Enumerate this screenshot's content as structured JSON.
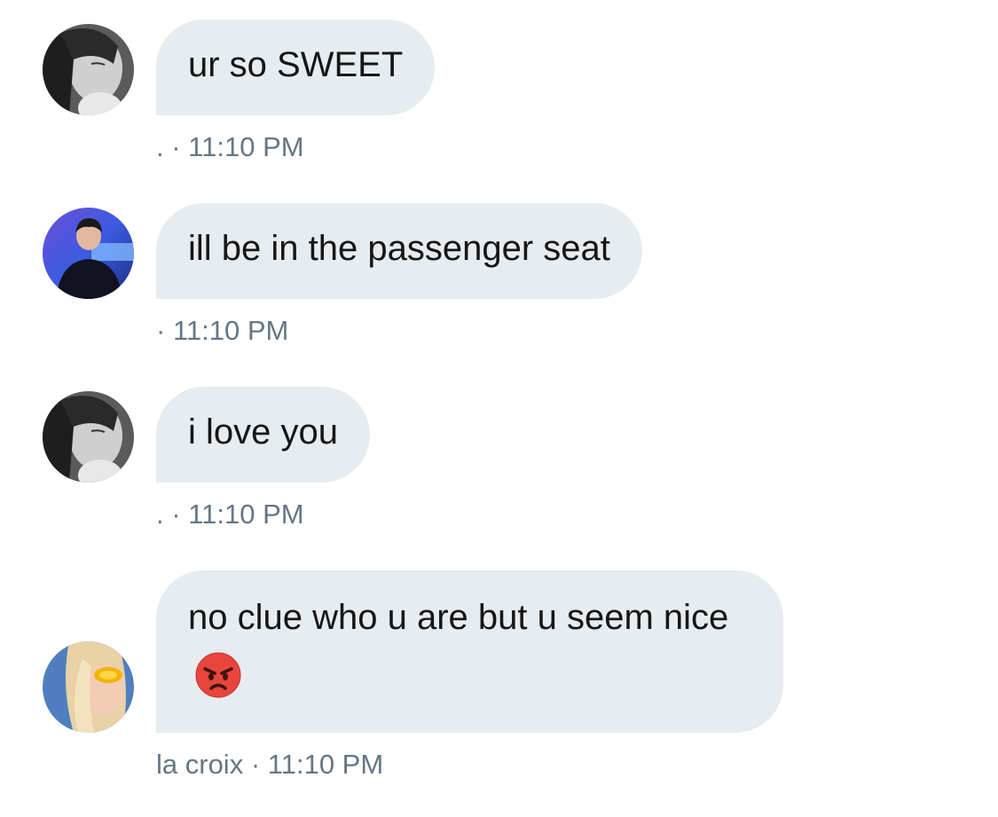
{
  "messages": [
    {
      "text": "ur so SWEET",
      "sender": ".",
      "separator": "·",
      "time": "11:10 PM",
      "avatar": "grayscale-portrait-avatar"
    },
    {
      "text": "ill be in the passenger seat",
      "sender": "",
      "separator": "·",
      "time": "11:10 PM",
      "avatar": "concert-stage-avatar"
    },
    {
      "text": "i love you",
      "sender": ".",
      "separator": "·",
      "time": "11:10 PM",
      "avatar": "grayscale-portrait-avatar"
    },
    {
      "text": "no clue who u are but u seem nice",
      "emoji": "angry-face-emoji",
      "sender": "la croix",
      "separator": "·",
      "time": "11:10 PM",
      "avatar": "blonde-sunglasses-avatar"
    }
  ],
  "colors": {
    "bubble_bg": "#e6ecf0",
    "text": "#14171a",
    "meta_text": "#657786",
    "emoji_red": "#e8453c"
  }
}
